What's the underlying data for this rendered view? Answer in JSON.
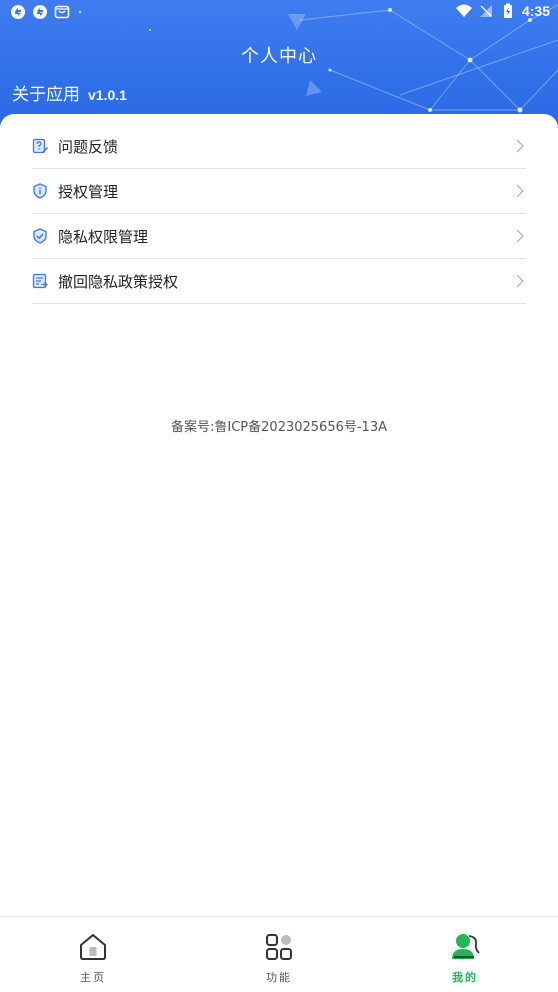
{
  "status_bar": {
    "time": "4:35",
    "left_icons": [
      "sync-icon",
      "sync-icon",
      "store-icon"
    ],
    "right_icons": [
      "wifi-icon",
      "signal-off-icon",
      "battery-charging-icon"
    ]
  },
  "header": {
    "title": "个人中心",
    "about_label": "关于应用",
    "version": "v1.0.1"
  },
  "menu": {
    "items": [
      {
        "label": "问题反馈",
        "icon": "feedback-icon"
      },
      {
        "label": "授权管理",
        "icon": "shield-info-icon"
      },
      {
        "label": "隐私权限管理",
        "icon": "shield-check-icon"
      },
      {
        "label": "撤回隐私政策授权",
        "icon": "document-revoke-icon"
      }
    ]
  },
  "footer": {
    "icp": "备案号:鲁ICP备2023025656号-13A"
  },
  "bottom_nav": {
    "items": [
      {
        "label": "主页",
        "icon": "home-icon"
      },
      {
        "label": "功能",
        "icon": "grid-icon"
      },
      {
        "label": "我的",
        "icon": "user-icon",
        "active": true
      }
    ]
  },
  "colors": {
    "header_blue": "#2f6fe8",
    "active_green": "#1db954",
    "icon_blue": "#3a78e6"
  }
}
